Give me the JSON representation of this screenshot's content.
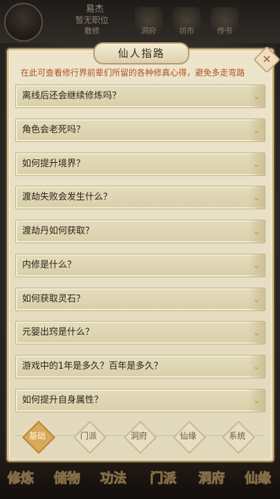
{
  "background": {
    "player": {
      "name": "易杰",
      "position": "暂无职位",
      "rank": "散修"
    },
    "top_icons": [
      {
        "icon": "cave-icon",
        "label": "洞府"
      },
      {
        "icon": "shop-icon",
        "label": "坊市"
      },
      {
        "icon": "book-icon",
        "label": "传书"
      }
    ],
    "bottom_tabs": [
      "修炼",
      "储物",
      "功法",
      "门派",
      "洞府",
      "仙缘"
    ]
  },
  "dialog": {
    "title": "仙人指路",
    "close_icon": "close-icon",
    "description": "在此可查看修行界前辈们所留的各种修真心得，避免多走弯路",
    "questions": [
      "离线后还会继续修炼吗？",
      "角色会老死吗？",
      "如何提升境界？",
      "渡劫失败会发生什么？",
      "渡劫丹如何获取？",
      "内修是什么？",
      "如何获取灵石？",
      "元婴出窍是什么？",
      "游戏中的1年是多久？百年是多久？",
      "如何提升自身属性？"
    ],
    "categories": [
      "基础",
      "门派",
      "洞府",
      "仙缘",
      "系统"
    ],
    "active_category": "基础",
    "colors": {
      "description": "#b0521f",
      "active_category": "#d8a95a"
    }
  }
}
